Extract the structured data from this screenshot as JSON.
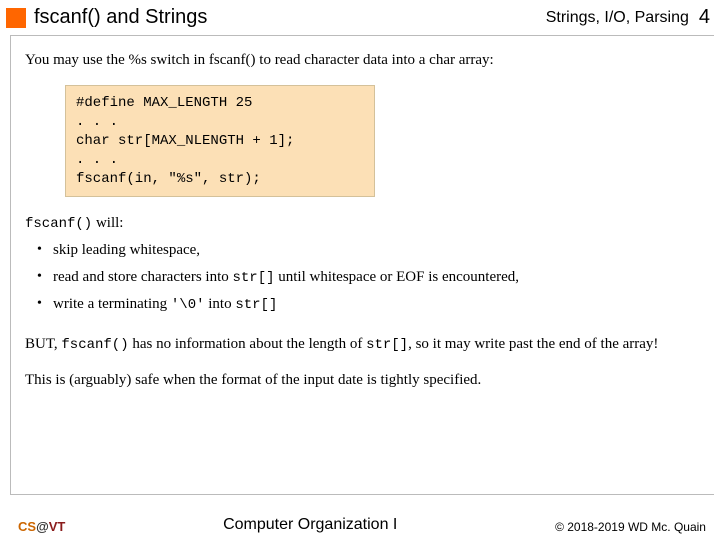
{
  "header": {
    "title": "fscanf() and Strings",
    "category": "Strings, I/O, Parsing",
    "page": "4"
  },
  "intro": "You may use the %s switch in fscanf() to read character data into a char array:",
  "code": "#define MAX_LENGTH 25\n. . .\nchar str[MAX_NLENGTH + 1];\n. . .\nfscanf(in, \"%s\", str);",
  "will": {
    "fn": "fscanf()",
    "rest": " will:"
  },
  "bullets": {
    "b1": "skip leading whitespace,",
    "b2_pre": "read and store characters into ",
    "b2_code": "str[]",
    "b2_post": " until whitespace or EOF is encountered,",
    "b3_pre": "write a terminating ",
    "b3_code1": "'\\0'",
    "b3_mid": " into ",
    "b3_code2": "str[]"
  },
  "but": {
    "pre": "BUT, ",
    "fn": "fscanf()",
    "mid": " has no information about the length of ",
    "arr": "str[]",
    "post": ", so it may write past the end of the array!"
  },
  "safe": "This is (arguably) safe when the format of the input date is tightly specified.",
  "footer": {
    "cs": "CS",
    "at": "@",
    "vt": "VT",
    "center": "Computer Organization I",
    "right": "© 2018-2019 WD Mc. Quain"
  }
}
